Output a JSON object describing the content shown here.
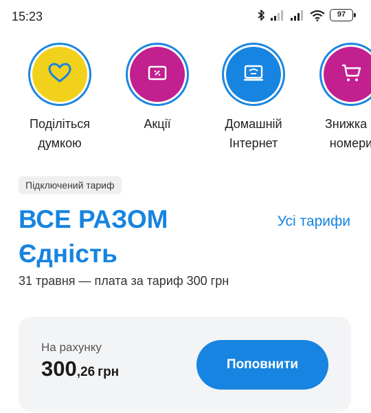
{
  "status_bar": {
    "time": "15:23",
    "battery": "97",
    "icons": [
      "bluetooth-icon",
      "signal-icon",
      "signal-icon",
      "wifi-icon",
      "battery-icon"
    ]
  },
  "shortcuts": [
    {
      "label": "Поділіться\nдумкою",
      "icon": "heart-icon",
      "color": "#f2d11c",
      "icon_color": "#1684e0"
    },
    {
      "label": "Акції",
      "icon": "coupon-icon",
      "color": "#c21f8f",
      "icon_color": "#ffffff"
    },
    {
      "label": "Домашній\nІнтернет",
      "icon": "router-icon",
      "color": "#1684e0",
      "icon_color": "#ffffff"
    },
    {
      "label": "Знижка н\nномери",
      "icon": "cart-icon",
      "color": "#c21f8f",
      "icon_color": "#ffffff"
    }
  ],
  "plan": {
    "tag": "Підключений тариф",
    "name_line1": "ВСЕ РАЗОМ",
    "name_line2": "Єдність",
    "all_plans_link": "Усі тарифи",
    "info": "31 травня — плата за тариф 300 грн"
  },
  "balance": {
    "caption": "На рахунку",
    "amount_main": "300",
    "amount_frac": ",26",
    "currency": "грн",
    "topup_label": "Поповнити"
  },
  "colors": {
    "accent": "#1684e0",
    "yellow": "#f2d11c",
    "magenta": "#c21f8f",
    "card_bg": "#f3f4f6"
  }
}
